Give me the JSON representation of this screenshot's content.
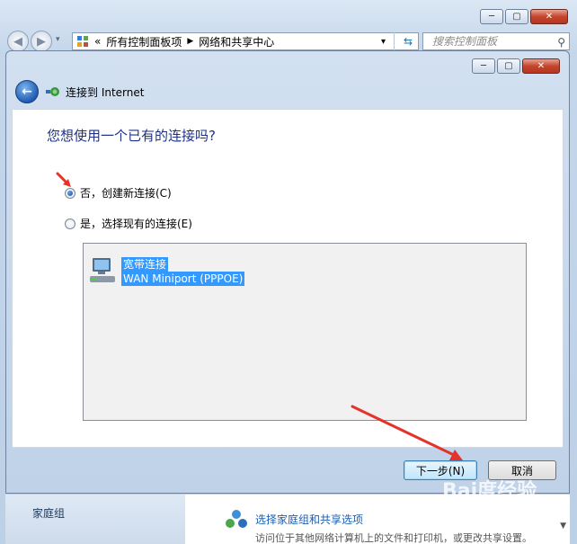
{
  "outer_window": {
    "controls": {
      "minimize": "─",
      "maximize": "▢",
      "close": "✕"
    },
    "address": {
      "overflow": "«",
      "crumbs": [
        "所有控制面板项",
        "网络和共享中心"
      ],
      "separator": "▶",
      "dropdown": "▾"
    },
    "search": {
      "placeholder": "搜索控制面板"
    },
    "bottom": {
      "sidebar_label": "家庭组",
      "link": "选择家庭组和共享选项",
      "description": "访问位于其他网络计算机上的文件和打印机，或更改共享设置。"
    }
  },
  "dialog": {
    "controls": {
      "minimize": "─",
      "maximize": "▢",
      "close": "✕"
    },
    "title": "连接到 Internet",
    "question": "您想使用一个已有的连接吗?",
    "options": [
      {
        "label": "否，创建新连接(C)",
        "checked": true
      },
      {
        "label": "是，选择现有的连接(E)",
        "checked": false
      }
    ],
    "connection": {
      "name": "宽带连接",
      "device": "WAN Miniport (PPPOE)"
    },
    "buttons": {
      "next": "下一步(N)",
      "cancel": "取消"
    }
  },
  "watermark": {
    "text": "Bai度经验"
  },
  "colors": {
    "accent_arrow": "#e5332a",
    "selection": "#3399ff",
    "heading": "#1e3287"
  }
}
